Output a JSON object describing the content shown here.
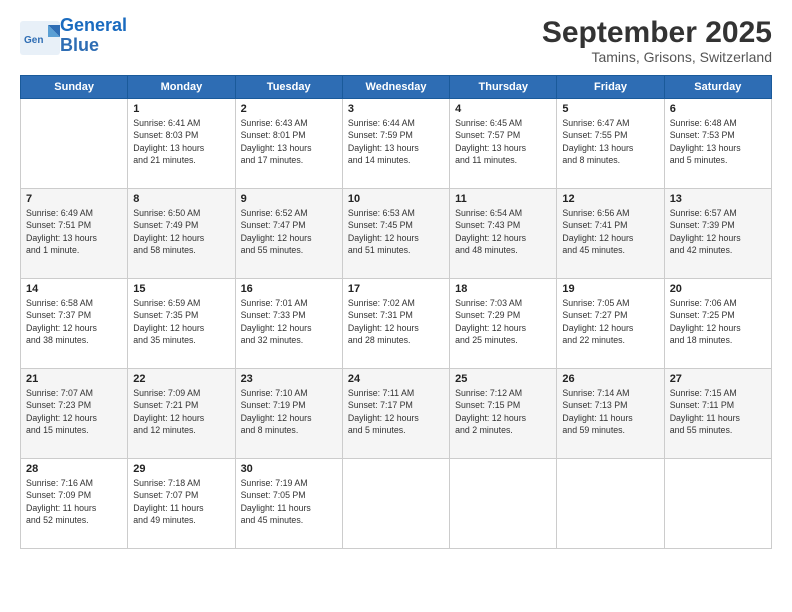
{
  "logo": {
    "line1": "General",
    "line2": "Blue"
  },
  "title": "September 2025",
  "location": "Tamins, Grisons, Switzerland",
  "days_of_week": [
    "Sunday",
    "Monday",
    "Tuesday",
    "Wednesday",
    "Thursday",
    "Friday",
    "Saturday"
  ],
  "weeks": [
    [
      {
        "day": "",
        "info": ""
      },
      {
        "day": "1",
        "info": "Sunrise: 6:41 AM\nSunset: 8:03 PM\nDaylight: 13 hours\nand 21 minutes."
      },
      {
        "day": "2",
        "info": "Sunrise: 6:43 AM\nSunset: 8:01 PM\nDaylight: 13 hours\nand 17 minutes."
      },
      {
        "day": "3",
        "info": "Sunrise: 6:44 AM\nSunset: 7:59 PM\nDaylight: 13 hours\nand 14 minutes."
      },
      {
        "day": "4",
        "info": "Sunrise: 6:45 AM\nSunset: 7:57 PM\nDaylight: 13 hours\nand 11 minutes."
      },
      {
        "day": "5",
        "info": "Sunrise: 6:47 AM\nSunset: 7:55 PM\nDaylight: 13 hours\nand 8 minutes."
      },
      {
        "day": "6",
        "info": "Sunrise: 6:48 AM\nSunset: 7:53 PM\nDaylight: 13 hours\nand 5 minutes."
      }
    ],
    [
      {
        "day": "7",
        "info": "Sunrise: 6:49 AM\nSunset: 7:51 PM\nDaylight: 13 hours\nand 1 minute."
      },
      {
        "day": "8",
        "info": "Sunrise: 6:50 AM\nSunset: 7:49 PM\nDaylight: 12 hours\nand 58 minutes."
      },
      {
        "day": "9",
        "info": "Sunrise: 6:52 AM\nSunset: 7:47 PM\nDaylight: 12 hours\nand 55 minutes."
      },
      {
        "day": "10",
        "info": "Sunrise: 6:53 AM\nSunset: 7:45 PM\nDaylight: 12 hours\nand 51 minutes."
      },
      {
        "day": "11",
        "info": "Sunrise: 6:54 AM\nSunset: 7:43 PM\nDaylight: 12 hours\nand 48 minutes."
      },
      {
        "day": "12",
        "info": "Sunrise: 6:56 AM\nSunset: 7:41 PM\nDaylight: 12 hours\nand 45 minutes."
      },
      {
        "day": "13",
        "info": "Sunrise: 6:57 AM\nSunset: 7:39 PM\nDaylight: 12 hours\nand 42 minutes."
      }
    ],
    [
      {
        "day": "14",
        "info": "Sunrise: 6:58 AM\nSunset: 7:37 PM\nDaylight: 12 hours\nand 38 minutes."
      },
      {
        "day": "15",
        "info": "Sunrise: 6:59 AM\nSunset: 7:35 PM\nDaylight: 12 hours\nand 35 minutes."
      },
      {
        "day": "16",
        "info": "Sunrise: 7:01 AM\nSunset: 7:33 PM\nDaylight: 12 hours\nand 32 minutes."
      },
      {
        "day": "17",
        "info": "Sunrise: 7:02 AM\nSunset: 7:31 PM\nDaylight: 12 hours\nand 28 minutes."
      },
      {
        "day": "18",
        "info": "Sunrise: 7:03 AM\nSunset: 7:29 PM\nDaylight: 12 hours\nand 25 minutes."
      },
      {
        "day": "19",
        "info": "Sunrise: 7:05 AM\nSunset: 7:27 PM\nDaylight: 12 hours\nand 22 minutes."
      },
      {
        "day": "20",
        "info": "Sunrise: 7:06 AM\nSunset: 7:25 PM\nDaylight: 12 hours\nand 18 minutes."
      }
    ],
    [
      {
        "day": "21",
        "info": "Sunrise: 7:07 AM\nSunset: 7:23 PM\nDaylight: 12 hours\nand 15 minutes."
      },
      {
        "day": "22",
        "info": "Sunrise: 7:09 AM\nSunset: 7:21 PM\nDaylight: 12 hours\nand 12 minutes."
      },
      {
        "day": "23",
        "info": "Sunrise: 7:10 AM\nSunset: 7:19 PM\nDaylight: 12 hours\nand 8 minutes."
      },
      {
        "day": "24",
        "info": "Sunrise: 7:11 AM\nSunset: 7:17 PM\nDaylight: 12 hours\nand 5 minutes."
      },
      {
        "day": "25",
        "info": "Sunrise: 7:12 AM\nSunset: 7:15 PM\nDaylight: 12 hours\nand 2 minutes."
      },
      {
        "day": "26",
        "info": "Sunrise: 7:14 AM\nSunset: 7:13 PM\nDaylight: 11 hours\nand 59 minutes."
      },
      {
        "day": "27",
        "info": "Sunrise: 7:15 AM\nSunset: 7:11 PM\nDaylight: 11 hours\nand 55 minutes."
      }
    ],
    [
      {
        "day": "28",
        "info": "Sunrise: 7:16 AM\nSunset: 7:09 PM\nDaylight: 11 hours\nand 52 minutes."
      },
      {
        "day": "29",
        "info": "Sunrise: 7:18 AM\nSunset: 7:07 PM\nDaylight: 11 hours\nand 49 minutes."
      },
      {
        "day": "30",
        "info": "Sunrise: 7:19 AM\nSunset: 7:05 PM\nDaylight: 11 hours\nand 45 minutes."
      },
      {
        "day": "",
        "info": ""
      },
      {
        "day": "",
        "info": ""
      },
      {
        "day": "",
        "info": ""
      },
      {
        "day": "",
        "info": ""
      }
    ]
  ]
}
